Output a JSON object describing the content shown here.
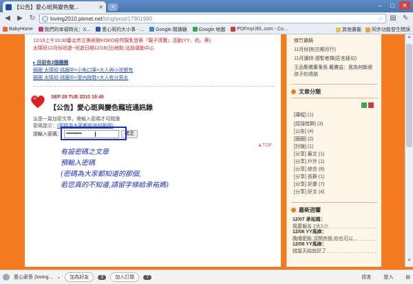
{
  "browser": {
    "tab_title": "【公告】愛心斑與變色龍...",
    "url_host": "loving2010.pixnet.net",
    "url_path": "/blog/post/17901990",
    "bookmarks": [
      {
        "label": "BabyHome",
        "color": "#e26a3a"
      },
      {
        "label": "我們的幸福時光：X...",
        "color": "#c23a7a"
      },
      {
        "label": "愛心斑的大小事 - ...",
        "color": "#2a55a8"
      },
      {
        "label": "Google 閱讀器",
        "color": "#3a8ad2"
      },
      {
        "label": "Google 地圖",
        "color": "#3aa852"
      },
      {
        "label": "PDFmyURL.com - Co...",
        "color": "#d23a3a"
      }
    ],
    "bookmarks_right": [
      "其他書籤",
      "同步功能發生錯誤"
    ]
  },
  "post": {
    "event_lines": [
      {
        "text": "12/19上午10:30臺北市立美術館KOKO自然親乳發表『親子導覽』活動(YY、杭、蔡)",
        "style": "red"
      },
      {
        "text": "太陽班12月份班遊~班遊日期12/18(日)地點:北投運動中心",
        "style": "red"
      }
    ],
    "section_heading": "▸ 目前有2個圈圈",
    "circle_lines": [
      "圈圈 太陽班-挑圈中<小魚口罩>大人與小孩都有",
      "圈圈 太陽班-挑圈中<室內拖鞋>大人有分男女"
    ],
    "date": "SEP 28 TUE 2010 19:46",
    "title": "【公告】愛心斑與變色龍班通訊錄",
    "protected_note": "這是一篇加密文章，需輸入密碼才可閱讀",
    "hint_label": "密碼提示：",
    "hint_text": "(密碼是大家都知道的那個)",
    "password_label": "請輸入密碼：",
    "password_value": "••••••••••••••",
    "confirm_label": "確定",
    "top_label": "▲TOP",
    "annotation_lines": [
      "有設密碼之文章",
      "預輸入密碼",
      "(密碼為大家都知道的那個,",
      "若您真的不知道,請留字條給承祐媽)"
    ]
  },
  "sidebar": {
    "top_lines": [
      {
        "text": "傑竹攝鏡",
        "style": "dark"
      },
      {
        "text": "11月份詩(古期月行)",
        "style": "dark"
      },
      {
        "text": "11月讀詩-澀暫者揮(匠言經句)",
        "style": "dark"
      },
      {
        "text": "王品集團董事長 戴勝益：我為何斷絕",
        "style": "dark"
      },
      {
        "text": "孩子的退路",
        "style": "dark"
      }
    ],
    "categories_title": "文章分類",
    "categories": [
      "[課程] (1)",
      "[認識桂群] (3)",
      "[公告] (4)",
      "[圈圈] (2)",
      "[討論] (1)",
      "[分享] 藝文 (1)",
      "[分享] 戶外 (1)",
      "[分享] 綜合 (8)",
      "[分享] 長群 (1)",
      "[分享] 好康 (7)",
      "[分享] 好文 (4)"
    ],
    "comments_title": "最新迴響",
    "comments": [
      {
        "meta": "12/07 承祐媽：",
        "text": "我要報名 2大1小"
      },
      {
        "meta": "12/06 YY馬麻：",
        "text": "晚嚐肥飯,沒開房帳,你也可以..."
      },
      {
        "meta": "12/06 YY馬麻：",
        "text": "錢當天給就好了"
      }
    ]
  },
  "bottom_bar": {
    "profile": "愛心家長 (loving...",
    "add_friend": "加為好友",
    "friend_count": "3",
    "subscribe": "加入訂閱",
    "subscribe_count": "7",
    "message": "訊言",
    "login": "登入"
  }
}
